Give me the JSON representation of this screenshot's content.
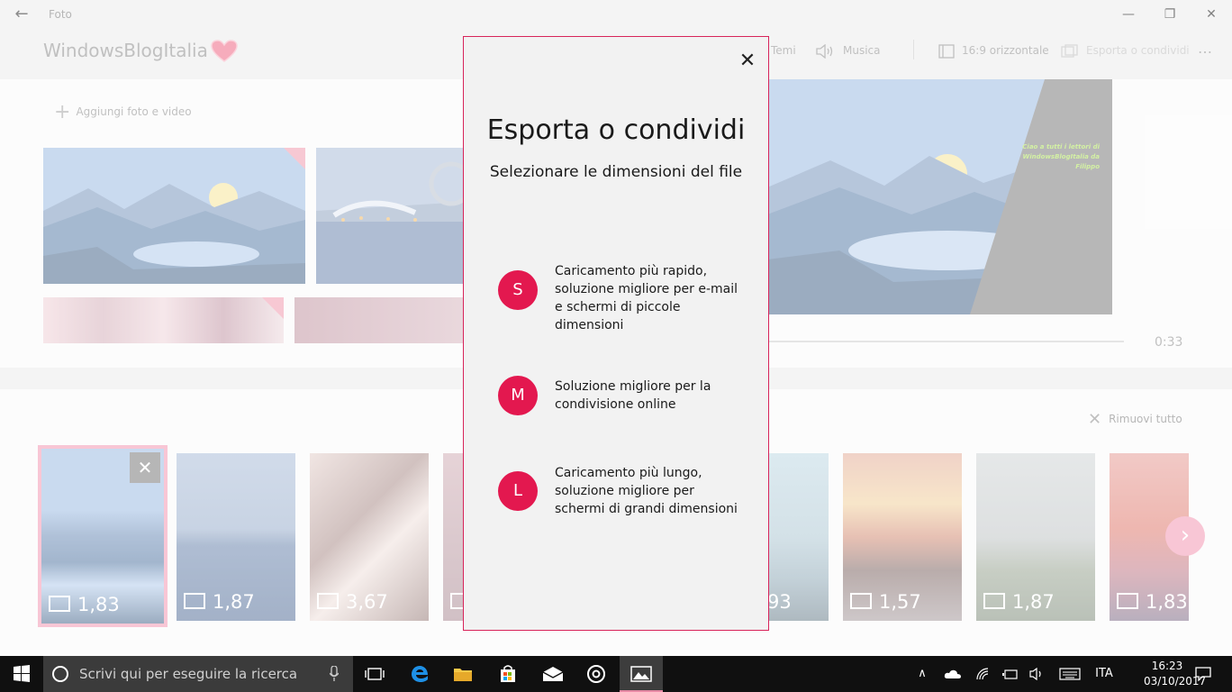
{
  "window": {
    "app_title": "Foto",
    "back_glyph": "←",
    "minimize_glyph": "—",
    "maximize_glyph": "❐",
    "close_glyph": "✕"
  },
  "header": {
    "project_title": "WindowsBlogItalia",
    "toolbar": {
      "themes_label": "Temi",
      "music_label": "Musica",
      "aspect_label": "16:9 orizzontale",
      "export_label": "Esporta o condividi",
      "more_glyph": "…"
    }
  },
  "library": {
    "add_label": "Aggiungi foto e video",
    "add_glyph": "+"
  },
  "preview": {
    "caption": "Ciao a tutti i lettori di WindowsBlogItalia da Filippo",
    "duration": "0:33"
  },
  "timeline": {
    "remove_all_label": "Rimuovi tutto",
    "remove_glyph": "✕",
    "card_close_glyph": "✕",
    "next_glyph": "›",
    "cards": [
      {
        "duration": "1,83"
      },
      {
        "duration": "1,87"
      },
      {
        "duration": "3,67"
      },
      {
        "duration": "93"
      },
      {
        "duration": "1,57"
      },
      {
        "duration": "1,87"
      },
      {
        "duration": "1,83"
      }
    ]
  },
  "dialog": {
    "title": "Esporta o condividi",
    "subtitle": "Selezionare le dimensioni del file",
    "close_glyph": "✕",
    "options": [
      {
        "badge": "S",
        "text": "Caricamento più rapido, soluzione migliore per e-mail e schermi di piccole dimensioni"
      },
      {
        "badge": "M",
        "text": "Soluzione migliore per la condivisione online"
      },
      {
        "badge": "L",
        "text": "Caricamento più lungo, soluzione migliore per schermi di grandi dimensioni"
      }
    ]
  },
  "taskbar": {
    "search_placeholder": "Scrivi qui per eseguire la ricerca",
    "language": "ITA",
    "time": "16:23",
    "date": "03/10/2017",
    "tray_up_glyph": "∧"
  },
  "colors": {
    "accent": "#e3184f",
    "dialog_border": "#d8245a",
    "selection": "#f4a3bb",
    "preview_caption": "#b8e86b"
  }
}
